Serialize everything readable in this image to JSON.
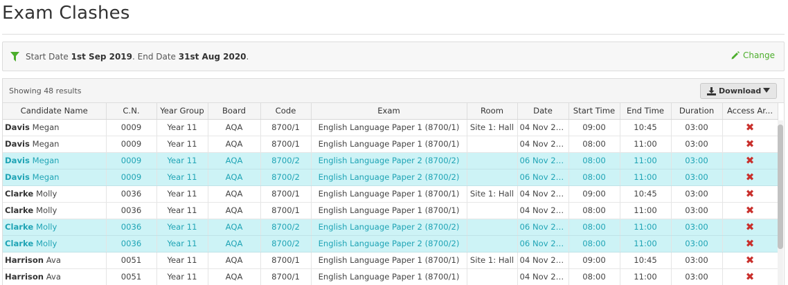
{
  "page": {
    "title": "Exam Clashes"
  },
  "filter": {
    "start_label": "Start Date",
    "start_value": "1st Sep 2019",
    "separator": ". ",
    "end_label": "End Date",
    "end_value": "31st Aug 2020",
    "end_suffix": ".",
    "change_label": "Change",
    "icon": "filter-icon",
    "accent_color": "#4cae2c"
  },
  "results": {
    "count_text": "Showing 48 results",
    "download_label": "Download"
  },
  "table": {
    "columns": [
      "Candidate Name",
      "C.N.",
      "Year Group",
      "Board",
      "Code",
      "Exam",
      "Room",
      "Date",
      "Start Time",
      "End Time",
      "Duration",
      "Access Ar..."
    ],
    "clash_color": "#cdf3f6",
    "clash_text_color": "#1fa4b5",
    "rows": [
      {
        "surname": "Davis",
        "forename": "Megan",
        "cn": "0009",
        "year": "Year 11",
        "board": "AQA",
        "code": "8700/1",
        "exam": "English Language Paper 1 (8700/1)",
        "room": "Site 1: Hall",
        "date": "04 Nov 20...",
        "start": "09:00",
        "end": "10:45",
        "duration": "03:00",
        "access": "cross",
        "highlight": false
      },
      {
        "surname": "Davis",
        "forename": "Megan",
        "cn": "0009",
        "year": "Year 11",
        "board": "AQA",
        "code": "8700/1",
        "exam": "English Language Paper 1 (8700/1)",
        "room": "",
        "date": "04 Nov 20...",
        "start": "08:00",
        "end": "11:00",
        "duration": "03:00",
        "access": "cross",
        "highlight": false
      },
      {
        "surname": "Davis",
        "forename": "Megan",
        "cn": "0009",
        "year": "Year 11",
        "board": "AQA",
        "code": "8700/2",
        "exam": "English Language Paper 2 (8700/2)",
        "room": "",
        "date": "06 Nov 20...",
        "start": "08:00",
        "end": "11:00",
        "duration": "03:00",
        "access": "cross",
        "highlight": true
      },
      {
        "surname": "Davis",
        "forename": "Megan",
        "cn": "0009",
        "year": "Year 11",
        "board": "AQA",
        "code": "8700/2",
        "exam": "English Language Paper 2 (8700/2)",
        "room": "",
        "date": "06 Nov 20...",
        "start": "08:00",
        "end": "11:00",
        "duration": "03:00",
        "access": "cross",
        "highlight": true
      },
      {
        "surname": "Clarke",
        "forename": "Molly",
        "cn": "0036",
        "year": "Year 11",
        "board": "AQA",
        "code": "8700/1",
        "exam": "English Language Paper 1 (8700/1)",
        "room": "Site 1: Hall",
        "date": "04 Nov 20...",
        "start": "09:00",
        "end": "10:45",
        "duration": "03:00",
        "access": "cross",
        "highlight": false
      },
      {
        "surname": "Clarke",
        "forename": "Molly",
        "cn": "0036",
        "year": "Year 11",
        "board": "AQA",
        "code": "8700/1",
        "exam": "English Language Paper 1 (8700/1)",
        "room": "",
        "date": "04 Nov 20...",
        "start": "08:00",
        "end": "11:00",
        "duration": "03:00",
        "access": "cross",
        "highlight": false
      },
      {
        "surname": "Clarke",
        "forename": "Molly",
        "cn": "0036",
        "year": "Year 11",
        "board": "AQA",
        "code": "8700/2",
        "exam": "English Language Paper 2 (8700/2)",
        "room": "",
        "date": "06 Nov 20...",
        "start": "08:00",
        "end": "11:00",
        "duration": "03:00",
        "access": "cross",
        "highlight": true
      },
      {
        "surname": "Clarke",
        "forename": "Molly",
        "cn": "0036",
        "year": "Year 11",
        "board": "AQA",
        "code": "8700/2",
        "exam": "English Language Paper 2 (8700/2)",
        "room": "",
        "date": "06 Nov 20...",
        "start": "08:00",
        "end": "11:00",
        "duration": "03:00",
        "access": "cross",
        "highlight": true
      },
      {
        "surname": "Harrison",
        "forename": "Ava",
        "cn": "0051",
        "year": "Year 11",
        "board": "AQA",
        "code": "8700/1",
        "exam": "English Language Paper 1 (8700/1)",
        "room": "Site 1: Hall",
        "date": "04 Nov 20...",
        "start": "09:00",
        "end": "10:45",
        "duration": "03:00",
        "access": "cross",
        "highlight": false
      },
      {
        "surname": "Harrison",
        "forename": "Ava",
        "cn": "0051",
        "year": "Year 11",
        "board": "AQA",
        "code": "8700/1",
        "exam": "English Language Paper 1 (8700/1)",
        "room": "",
        "date": "04 Nov 20...",
        "start": "08:00",
        "end": "11:00",
        "duration": "03:00",
        "access": "cross",
        "highlight": false
      }
    ]
  }
}
